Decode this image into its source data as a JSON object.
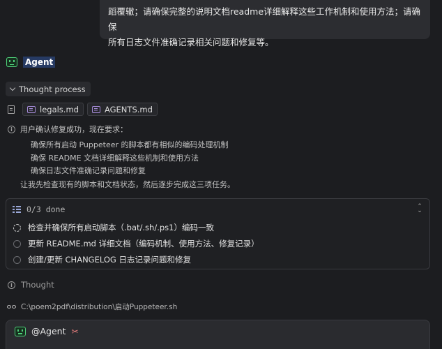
{
  "user_message": {
    "line1": "蹈覆辙；请确保完整的说明文档readme详细解释这些工作机制和使用方法；请确保",
    "line2": "所有日志文件准确记录相关问题和修复等。"
  },
  "agent": {
    "label": "Agent",
    "icon": "robot-icon"
  },
  "thought_process": {
    "label": "Thought process",
    "files": [
      "legals.md",
      "AGENTS.md"
    ],
    "intro": "用户确认修复成功，现在要求：",
    "bullets": [
      "确保所有启动 Puppeteer 的脚本都有相似的编码处理机制",
      "确保 README 文档详细解释这些机制和使用方法",
      "确保日志文件准确记录问题和修复"
    ],
    "next": "让我先检查现有的脚本和文档状态，然后逐步完成这三项任务。"
  },
  "todo": {
    "count": "0/3 done",
    "items": [
      {
        "label": "检查并确保所有启动脚本（.bat/.sh/.ps1）编码一致",
        "status": "in-progress"
      },
      {
        "label": "更新 README.md 详细文档（编码机制、使用方法、修复记录）",
        "status": "pending"
      },
      {
        "label": "创建/更新 CHANGELOG 日志记录问题和修复",
        "status": "pending"
      }
    ]
  },
  "thought": {
    "label": "Thought"
  },
  "file_read": {
    "path": "C:\\poem2pdf\\distribution\\启动Puppeteer.sh"
  },
  "composer": {
    "mention": "@Agent"
  },
  "colors": {
    "background": "#1c1d20",
    "bubble": "#2c2d31",
    "accent_green": "#4fd17a",
    "agent_highlight": "#263a63"
  }
}
